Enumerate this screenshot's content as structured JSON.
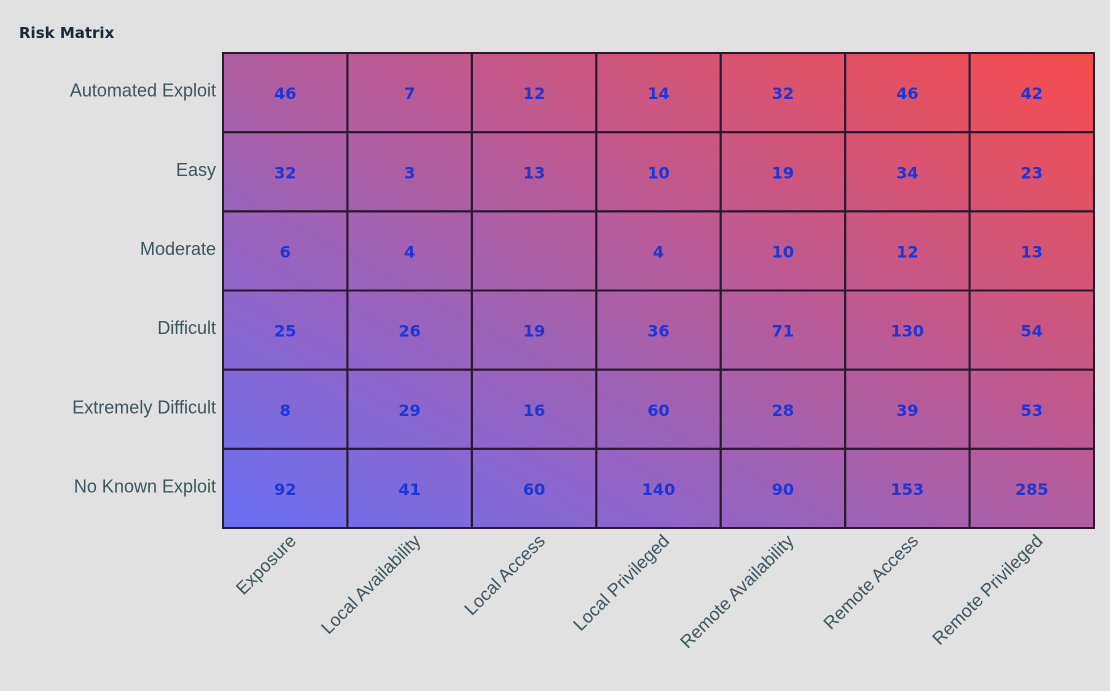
{
  "chart_data": {
    "type": "heatmap",
    "title": "Risk Matrix",
    "xlabel": "",
    "ylabel": "",
    "x_categories": [
      "Exposure",
      "Local Availability",
      "Local Access",
      "Local Privileged",
      "Remote Availability",
      "Remote Access",
      "Remote Privileged"
    ],
    "y_categories": [
      "Automated Exploit",
      "Easy",
      "Moderate",
      "Difficult",
      "Extremely Difficult",
      "No Known Exploit"
    ],
    "values": [
      [
        46,
        7,
        12,
        14,
        32,
        46,
        42
      ],
      [
        32,
        3,
        13,
        10,
        19,
        34,
        23
      ],
      [
        6,
        4,
        null,
        4,
        10,
        12,
        13
      ],
      [
        25,
        26,
        19,
        36,
        71,
        130,
        54
      ],
      [
        8,
        29,
        16,
        60,
        28,
        39,
        53
      ],
      [
        92,
        41,
        60,
        140,
        90,
        153,
        285
      ]
    ],
    "color_scale": {
      "low": "#6a6ff5",
      "high": "#f74c4c",
      "direction": "bottom-left to top-right"
    },
    "value_label_color": "#1e36d6",
    "grid": true,
    "legend": "none"
  }
}
